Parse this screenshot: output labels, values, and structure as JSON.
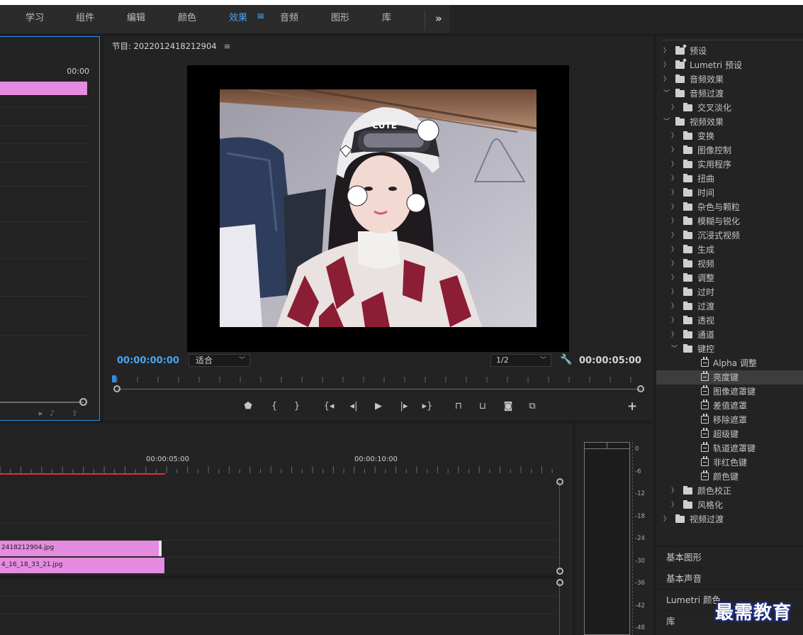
{
  "menu": {
    "items": [
      {
        "label": "学习",
        "active": false
      },
      {
        "label": "组件",
        "active": false
      },
      {
        "label": "编辑",
        "active": false
      },
      {
        "label": "颜色",
        "active": false
      },
      {
        "label": "效果",
        "active": true
      },
      {
        "label": "音频",
        "active": false
      },
      {
        "label": "图形",
        "active": false
      },
      {
        "label": "库",
        "active": false
      }
    ],
    "more_label": "»"
  },
  "source": {
    "timecode": "00:00"
  },
  "program": {
    "title": "节目: 2022012418212904",
    "timecode_current": "00:00:00:00",
    "timecode_duration": "00:00:05:00",
    "zoom_selected": "适合",
    "resolution_selected": "1/2",
    "photo_sticker_text": "CUTE"
  },
  "timeline": {
    "ruler_labels": [
      "00:00:05:00",
      "00:00:10:00"
    ],
    "clips": [
      "2418212904.jpg",
      "4_16_18_33_21.jpg"
    ]
  },
  "meter": {
    "labels": [
      "0",
      "-6",
      "-12",
      "-18",
      "-24",
      "-30",
      "-36",
      "-42",
      "-48"
    ]
  },
  "effects": {
    "items": [
      {
        "label": "预设",
        "level": 0,
        "type": "folder-star",
        "expanded": false
      },
      {
        "label": "Lumetri 预设",
        "level": 0,
        "type": "folder-star",
        "expanded": false
      },
      {
        "label": "音频效果",
        "level": 0,
        "type": "folder",
        "expanded": false
      },
      {
        "label": "音频过渡",
        "level": 0,
        "type": "folder",
        "expanded": true
      },
      {
        "label": "交叉淡化",
        "level": 1,
        "type": "folder",
        "expanded": false
      },
      {
        "label": "视频效果",
        "level": 0,
        "type": "folder",
        "expanded": true
      },
      {
        "label": "变换",
        "level": 1,
        "type": "folder",
        "expanded": false
      },
      {
        "label": "图像控制",
        "level": 1,
        "type": "folder",
        "expanded": false
      },
      {
        "label": "实用程序",
        "level": 1,
        "type": "folder",
        "expanded": false
      },
      {
        "label": "扭曲",
        "level": 1,
        "type": "folder",
        "expanded": false
      },
      {
        "label": "时间",
        "level": 1,
        "type": "folder",
        "expanded": false
      },
      {
        "label": "杂色与颗粒",
        "level": 1,
        "type": "folder",
        "expanded": false
      },
      {
        "label": "模糊与锐化",
        "level": 1,
        "type": "folder",
        "expanded": false
      },
      {
        "label": "沉浸式视频",
        "level": 1,
        "type": "folder",
        "expanded": false
      },
      {
        "label": "生成",
        "level": 1,
        "type": "folder",
        "expanded": false
      },
      {
        "label": "视频",
        "level": 1,
        "type": "folder",
        "expanded": false
      },
      {
        "label": "调整",
        "level": 1,
        "type": "folder",
        "expanded": false
      },
      {
        "label": "过时",
        "level": 1,
        "type": "folder",
        "expanded": false
      },
      {
        "label": "过渡",
        "level": 1,
        "type": "folder",
        "expanded": false
      },
      {
        "label": "透视",
        "level": 1,
        "type": "folder",
        "expanded": false
      },
      {
        "label": "通道",
        "level": 1,
        "type": "folder",
        "expanded": false
      },
      {
        "label": "键控",
        "level": 1,
        "type": "folder",
        "expanded": true
      },
      {
        "label": "Alpha 调整",
        "level": 2,
        "type": "effect",
        "selected": false
      },
      {
        "label": "亮度键",
        "level": 2,
        "type": "effect",
        "selected": true
      },
      {
        "label": "图像遮罩键",
        "level": 2,
        "type": "effect",
        "selected": false
      },
      {
        "label": "差值遮罩",
        "level": 2,
        "type": "effect",
        "selected": false
      },
      {
        "label": "移除遮罩",
        "level": 2,
        "type": "effect",
        "selected": false
      },
      {
        "label": "超级键",
        "level": 2,
        "type": "effect",
        "selected": false
      },
      {
        "label": "轨道遮罩键",
        "level": 2,
        "type": "effect",
        "selected": false
      },
      {
        "label": "非红色键",
        "level": 2,
        "type": "effect",
        "selected": false
      },
      {
        "label": "颜色键",
        "level": 2,
        "type": "effect",
        "selected": false
      },
      {
        "label": "颜色校正",
        "level": 1,
        "type": "folder",
        "expanded": false
      },
      {
        "label": "风格化",
        "level": 1,
        "type": "folder",
        "expanded": false
      },
      {
        "label": "视频过渡",
        "level": 0,
        "type": "folder",
        "expanded": false
      }
    ]
  },
  "side_tabs": [
    "基本图形",
    "基本声音",
    "Lumetri 颜色",
    "库"
  ],
  "watermark": "最需教育",
  "colors": {
    "accent": "#4aa3ee",
    "clip": "#e58be0",
    "playhead": "#e03030",
    "selection": "#2d8ceb"
  }
}
